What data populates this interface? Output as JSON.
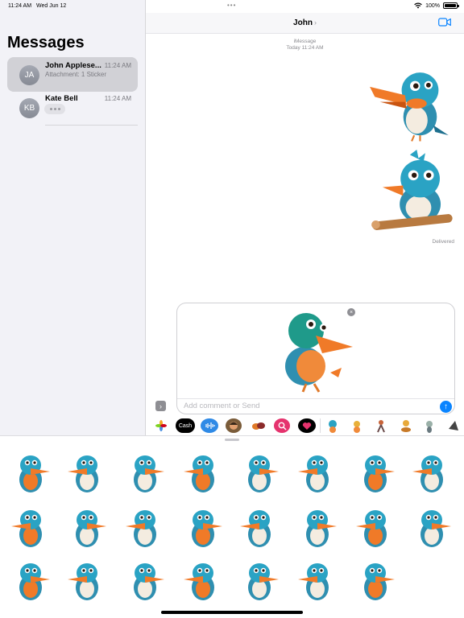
{
  "status": {
    "time": "11:24 AM",
    "date": "Wed Jun 12",
    "battery": "100%"
  },
  "sidebar": {
    "title": "Messages",
    "conversations": [
      {
        "initials": "JA",
        "name": "John Applese...",
        "time": "11:24 AM",
        "preview": "Attachment: 1 Sticker"
      },
      {
        "initials": "KB",
        "name": "Kate Bell",
        "time": "11:24 AM",
        "preview": ""
      }
    ]
  },
  "chat": {
    "contact": "John",
    "service": "iMessage",
    "timestamp": "Today 11:24 AM",
    "delivered": "Delivered",
    "compose_placeholder": "Add comment or Send"
  },
  "apps": [
    "photos-icon",
    "apple-cash-icon",
    "audio-message-icon",
    "memoji-icon",
    "stickers-icon",
    "search-images-icon",
    "digital-touch-icon"
  ],
  "apple_cash_label": "Cash",
  "colors": {
    "accent": "#0a84ff",
    "bird_blue": "#2f8fb0",
    "bird_orange": "#f07a28"
  }
}
